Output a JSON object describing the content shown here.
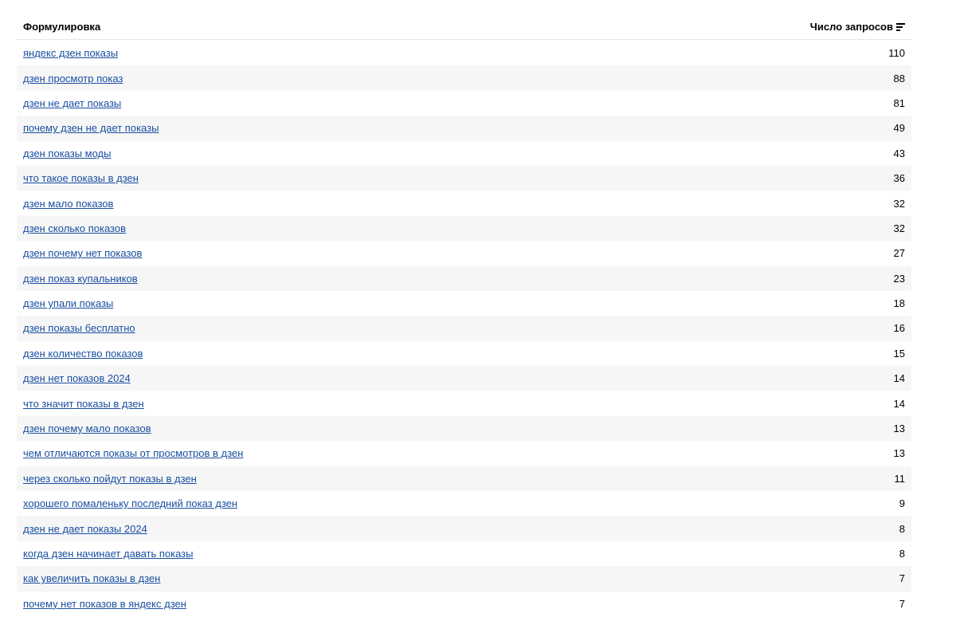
{
  "table": {
    "header": {
      "phrase": "Формулировка",
      "count": "Число запросов",
      "sort_icon": "sort-descending-icon"
    },
    "rows": [
      {
        "phrase": "яндекс дзен показы",
        "count": "110"
      },
      {
        "phrase": "дзен просмотр показ",
        "count": "88"
      },
      {
        "phrase": "дзен не дает показы",
        "count": "81"
      },
      {
        "phrase": "почему дзен не дает показы",
        "count": "49"
      },
      {
        "phrase": "дзен показы моды",
        "count": "43"
      },
      {
        "phrase": "что такое показы в дзен",
        "count": "36"
      },
      {
        "phrase": "дзен мало показов",
        "count": "32"
      },
      {
        "phrase": "дзен сколько показов",
        "count": "32"
      },
      {
        "phrase": "дзен почему нет показов",
        "count": "27"
      },
      {
        "phrase": "дзен показ купальников",
        "count": "23"
      },
      {
        "phrase": "дзен упали показы",
        "count": "18"
      },
      {
        "phrase": "дзен показы бесплатно",
        "count": "16"
      },
      {
        "phrase": "дзен количество показов",
        "count": "15"
      },
      {
        "phrase": "дзен нет показов 2024",
        "count": "14"
      },
      {
        "phrase": "что значит показы в дзен",
        "count": "14"
      },
      {
        "phrase": "дзен почему мало показов",
        "count": "13"
      },
      {
        "phrase": "чем отличаются показы от просмотров в дзен",
        "count": "13"
      },
      {
        "phrase": "через сколько пойдут показы в дзен",
        "count": "11"
      },
      {
        "phrase": "хорошего помаленьку последний показ дзен",
        "count": "9"
      },
      {
        "phrase": "дзен не дает показы 2024",
        "count": "8"
      },
      {
        "phrase": "когда дзен начинает давать показы",
        "count": "8"
      },
      {
        "phrase": "как увеличить показы в дзен",
        "count": "7"
      },
      {
        "phrase": "почему нет показов в яндекс дзен",
        "count": "7"
      }
    ]
  }
}
